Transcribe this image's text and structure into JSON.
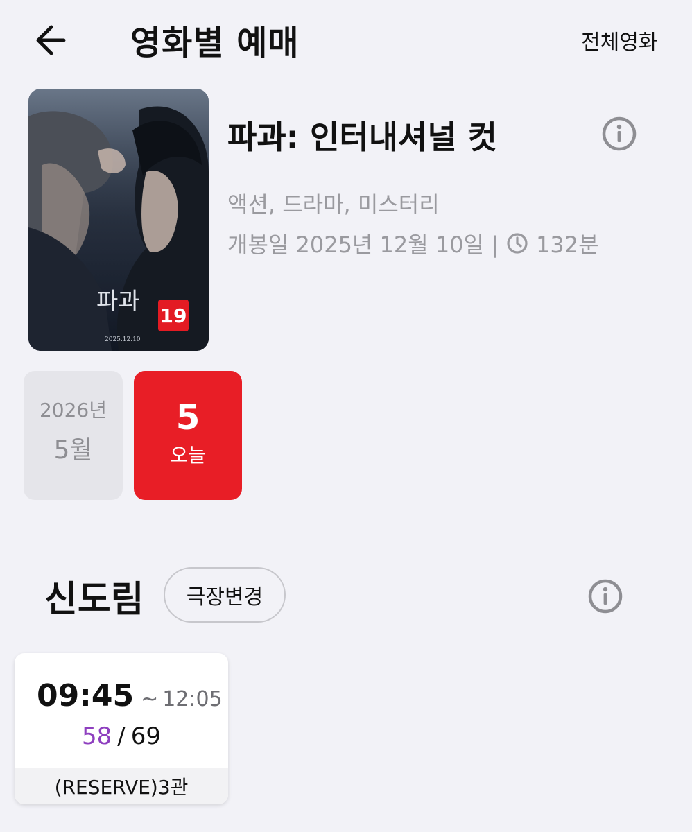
{
  "header": {
    "title": "영화별 예매",
    "all_movies_label": "전체영화"
  },
  "movie": {
    "title": "파과: 인터내셔널 컷",
    "genres": "액션, 드라마, 미스터리",
    "release_prefix": "개봉일 2025년 12월 10일 |",
    "runtime": "132분",
    "age_rating": "19",
    "poster_title": "파과",
    "poster_date": "2025.12.10"
  },
  "dates": {
    "year": "2026년",
    "month": "5월",
    "selected_day": "5",
    "selected_label": "오늘"
  },
  "theater": {
    "name": "신도림",
    "change_label": "극장변경"
  },
  "showtimes": [
    {
      "start": "09:45",
      "tilde": "~",
      "end": "12:05",
      "seats_available": "58",
      "seat_separator": "/",
      "seats_total": "69",
      "screen": "(RESERVE)3관"
    }
  ],
  "colors": {
    "accent_red": "#e81e26",
    "seats_purple": "#8e3fbf",
    "background": "#f2f2f7"
  }
}
